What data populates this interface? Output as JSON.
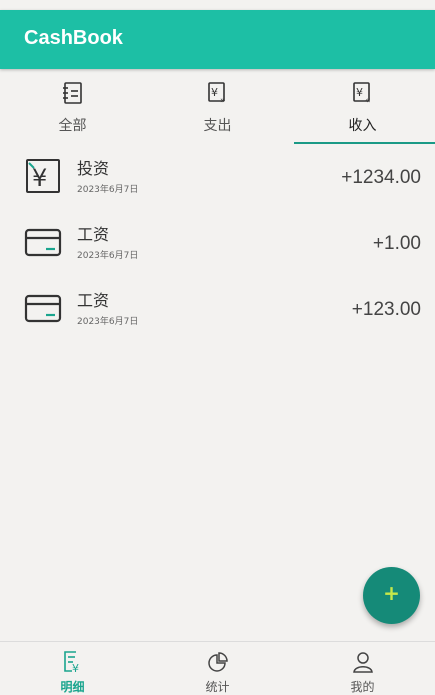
{
  "app": {
    "title": "CashBook"
  },
  "tabs": [
    {
      "label": "全部",
      "icon": "ledger-icon"
    },
    {
      "label": "支出",
      "icon": "expense-icon"
    },
    {
      "label": "收入",
      "icon": "income-icon"
    }
  ],
  "active_tab": "收入",
  "records": [
    {
      "name": "投资",
      "date": "2023年6月7日",
      "amount": "+1234.00",
      "icon": "yuan-icon"
    },
    {
      "name": "工资",
      "date": "2023年6月7日",
      "amount": "+1.00",
      "icon": "card-icon"
    },
    {
      "name": "工资",
      "date": "2023年6月7日",
      "amount": "+123.00",
      "icon": "card-icon"
    }
  ],
  "fab": {
    "label": "+"
  },
  "bottom_nav": [
    {
      "label": "明细",
      "icon": "details-icon"
    },
    {
      "label": "统计",
      "icon": "pie-chart-icon"
    },
    {
      "label": "我的",
      "icon": "user-icon"
    }
  ],
  "colors": {
    "primary": "#1dbfa5",
    "accent": "#158a78",
    "fab_plus": "#c6e84a",
    "active_nav": "#1aa58e"
  }
}
